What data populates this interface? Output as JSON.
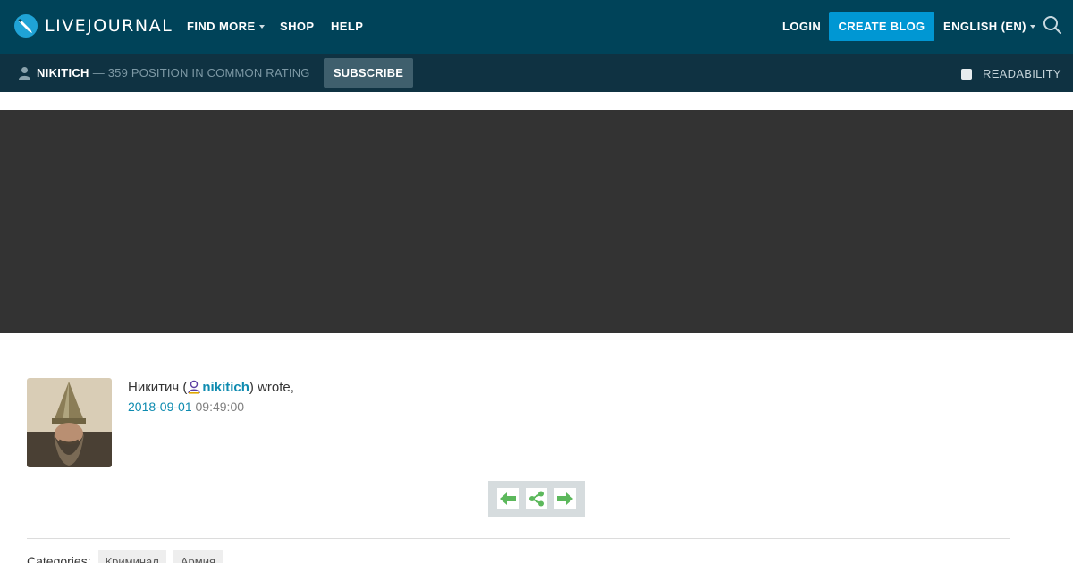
{
  "header": {
    "logo_text": "LIVEJOURNAL",
    "nav": {
      "find_more": "FIND MORE",
      "shop": "SHOP",
      "help": "HELP"
    },
    "login": "LOGIN",
    "create_blog": "CREATE BLOG",
    "language": "ENGLISH (EN)",
    "colors": {
      "bar": "#004359",
      "accent": "#0097d3"
    }
  },
  "subheader": {
    "username": "NIKITICH",
    "rating": "— 359 POSITION IN COMMON RATING",
    "subscribe": "SUBSCRIBE",
    "readability": "READABILITY"
  },
  "post": {
    "author_name": "Никитич (",
    "author_login": "nikitich",
    "wrote": ") wrote,",
    "date": "2018-09-01",
    "time": "09:49:00",
    "controls": [
      "prev-arrow-icon",
      "share-icon",
      "next-arrow-icon"
    ],
    "categories_label": "Categories:",
    "categories": [
      "Криминал",
      "Армия"
    ]
  }
}
